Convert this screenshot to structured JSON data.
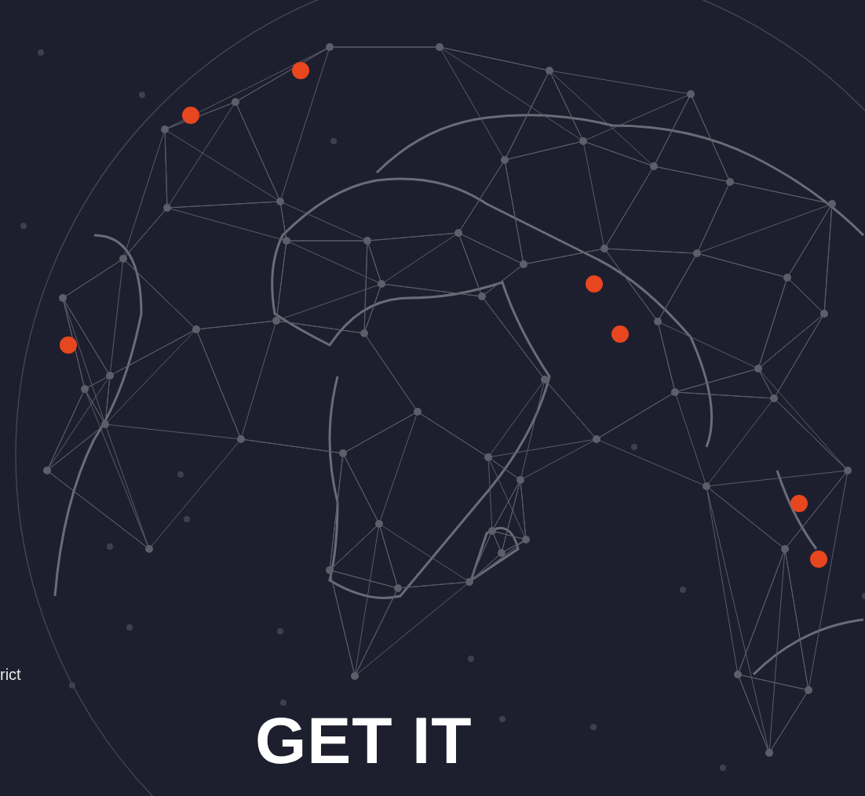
{
  "side_text": "rict",
  "heading": "GET IT"
}
